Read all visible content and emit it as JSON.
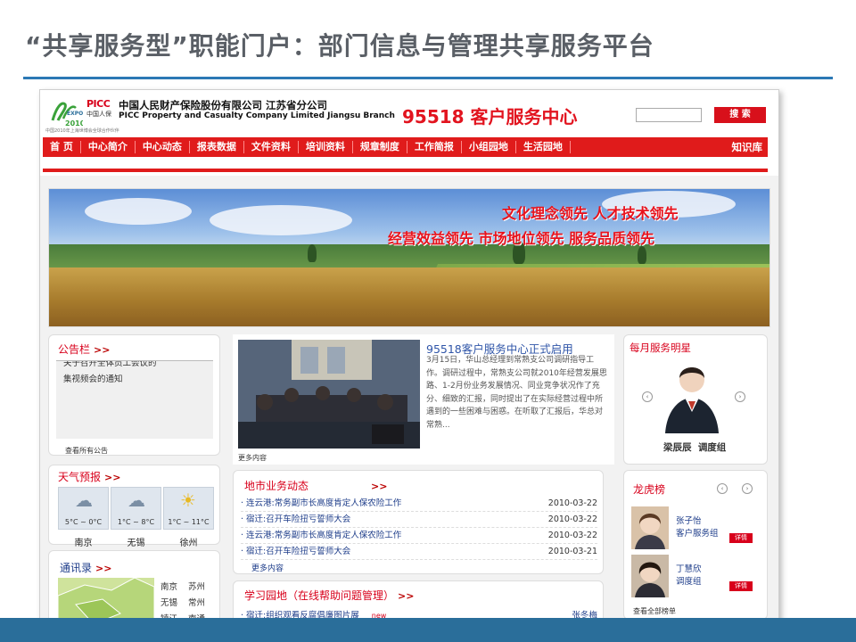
{
  "slide": {
    "title": "“共享服务型”职能门户：部门信息与管理共享服务平台"
  },
  "header": {
    "expo_small_text": "中国2010年上海世博会全球合作伙伴",
    "picc_brand": "PICC",
    "picc_sub": "中国人保",
    "company_cn": "中国人民财产保险股份有限公司 江苏省分公司",
    "company_en": "PICC Property and Casualty Company Limited Jiangsu Branch",
    "service_title": "95518 客户服务中心",
    "search_value": "",
    "search_button": "搜 索"
  },
  "nav": {
    "items": [
      "首 页",
      "中心简介",
      "中心动态",
      "报表数据",
      "文件资料",
      "培训资料",
      "规章制度",
      "工作简报",
      "小组园地",
      "生活园地"
    ],
    "right": "知识库"
  },
  "banner": {
    "slogan_line1": "文化理念领先  人才技术领先",
    "slogan_line2": "经营效益领先  市场地位领先  服务品质领先"
  },
  "notice": {
    "title": "公告栏",
    "arrows": ">>",
    "lines": [
      "关于召开全体员工会议的",
      "集视频会的通知"
    ],
    "more": "查看所有公告"
  },
  "weather": {
    "title": "天气预报",
    "arrows": ">>",
    "cities": [
      {
        "city": "南京",
        "temp": "5°C ~ 0°C",
        "icon": "snow-cloud-icon"
      },
      {
        "city": "无锡",
        "temp": "1°C ~ 8°C",
        "icon": "snow-cloud-icon"
      },
      {
        "city": "徐州",
        "temp": "1°C ~ 11°C",
        "icon": "sun-cloud-icon"
      }
    ]
  },
  "contacts": {
    "title": "通讯录",
    "arrows": ">>",
    "cities_left": [
      "南京",
      "无锡",
      "镇江"
    ],
    "cities_right": [
      "苏州",
      "常州",
      "南通"
    ]
  },
  "news": {
    "headline": "95518客户服务中心正式启用",
    "body": "3月15日，华山总经理到常熟支公司调研指导工作。调研过程中，常熟支公司就2010年经营发展思路、1-2月份业务发展情况、同业竞争状况作了充分、细致的汇报，同时提出了在实际经营过程中所遇到的一些困难与困惑。在听取了汇报后，华总对常熟...",
    "more": "更多内容"
  },
  "local": {
    "title": "地市业务动态",
    "arrows": ">>",
    "rows": [
      {
        "text": "· 连云港:常务副市长高度肯定人保农险工作",
        "date": "2010-03-22"
      },
      {
        "text": "· 宿迁:召开车险扭亏誓师大会",
        "date": "2010-03-22"
      },
      {
        "text": "· 连云港:常务副市长高度肯定人保农险工作",
        "date": "2010-03-22"
      },
      {
        "text": "· 宿迁:召开车险扭亏誓师大会",
        "date": "2010-03-21"
      }
    ],
    "more": "更多内容"
  },
  "study": {
    "title": "学习园地（在线帮助问题管理）",
    "arrows": ">>",
    "row_text": "· 宿迁:组织观看反腐倡廉图片展",
    "row_badge": "new",
    "row_author": "张冬梅"
  },
  "monthly_star": {
    "title": "每月服务明星",
    "name": "梁辰辰",
    "team": "调度组"
  },
  "ranking": {
    "title": "龙虎榜",
    "items": [
      {
        "name": "张子怡",
        "dept": "客户服务组",
        "button": "详情"
      },
      {
        "name": "丁慧欣",
        "dept": "调度组",
        "button": "详情"
      }
    ],
    "more": "查看全部榜单"
  },
  "colors": {
    "brand_red": "#e01b1b",
    "title_gray": "#5a5f66",
    "accent_blue": "#2c79b5",
    "link_blue": "#1e3d8a"
  }
}
